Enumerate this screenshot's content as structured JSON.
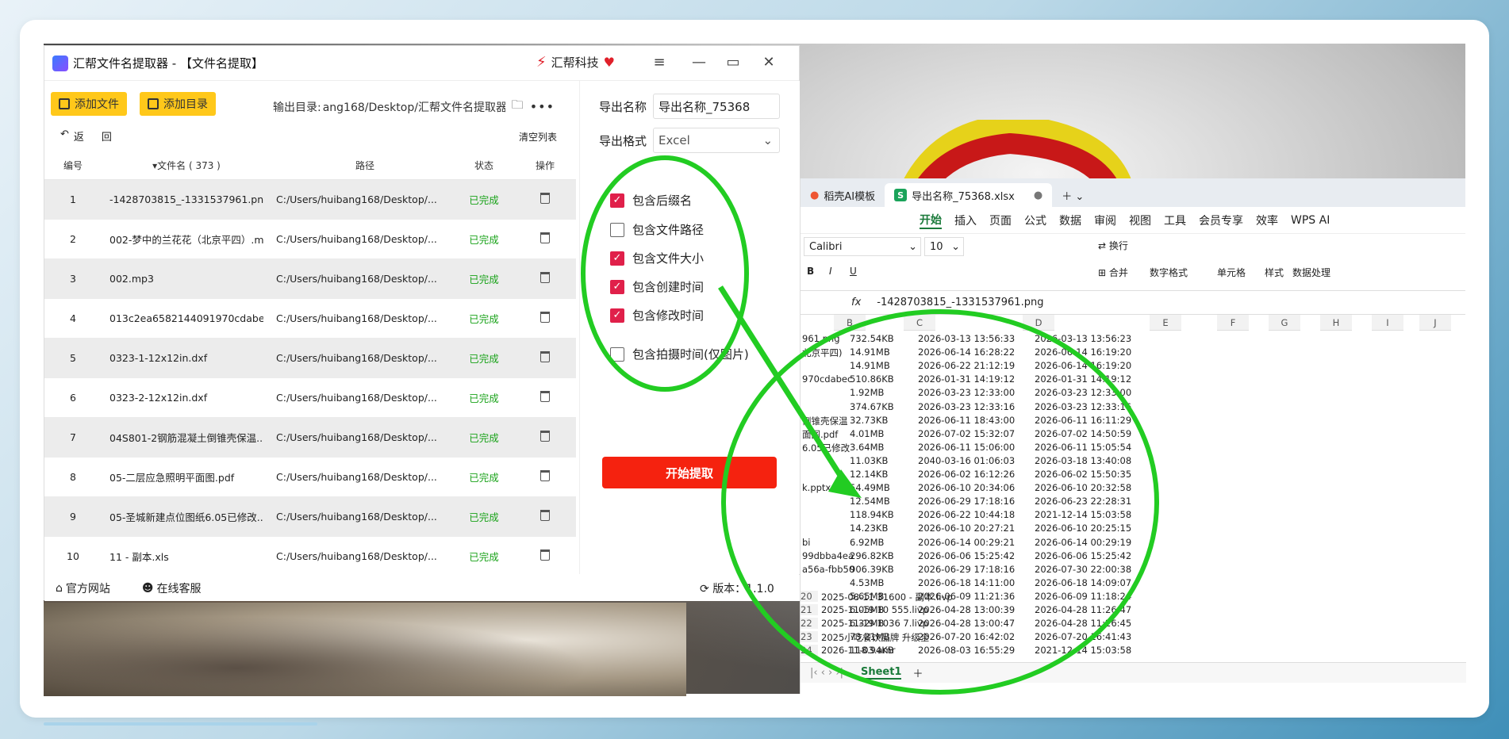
{
  "app": {
    "title": "汇帮文件名提取器 - 【文件名提取】",
    "brand": "汇帮科技",
    "add_file": "添加文件",
    "add_dir": "添加目录",
    "output_dir_label": "输出目录:",
    "output_dir_value": "ang168/Desktop/汇帮文件名提取器",
    "back": "返",
    "back2": "回",
    "clear": "清空列表",
    "headers": {
      "no": "编号",
      "name": "▾文件名 ( 373 )",
      "path": "路径",
      "status": "状态",
      "op": "操作"
    },
    "rows": [
      {
        "no": "1",
        "name": "-1428703815_-1331537961.png",
        "path": "C:/Users/huibang168/Desktop/...",
        "status": "已完成"
      },
      {
        "no": "2",
        "name": "002-梦中的兰花花（北京平四）.m...",
        "path": "C:/Users/huibang168/Desktop/...",
        "status": "已完成"
      },
      {
        "no": "3",
        "name": "002.mp3",
        "path": "C:/Users/huibang168/Desktop/...",
        "status": "已完成"
      },
      {
        "no": "4",
        "name": "013c2ea6582144091970cdabec...",
        "path": "C:/Users/huibang168/Desktop/...",
        "status": "已完成"
      },
      {
        "no": "5",
        "name": "0323-1-12x12in.dxf",
        "path": "C:/Users/huibang168/Desktop/...",
        "status": "已完成"
      },
      {
        "no": "6",
        "name": "0323-2-12x12in.dxf",
        "path": "C:/Users/huibang168/Desktop/...",
        "status": "已完成"
      },
      {
        "no": "7",
        "name": "04S801-2钢筋混凝土倒锥壳保温...",
        "path": "C:/Users/huibang168/Desktop/...",
        "status": "已完成"
      },
      {
        "no": "8",
        "name": "05-二层应急照明平面图.pdf",
        "path": "C:/Users/huibang168/Desktop/...",
        "status": "已完成"
      },
      {
        "no": "9",
        "name": "05-圣城新建点位图纸6.05已修改....",
        "path": "C:/Users/huibang168/Desktop/...",
        "status": "已完成"
      },
      {
        "no": "10",
        "name": "11 - 副本.xls",
        "path": "C:/Users/huibang168/Desktop/...",
        "status": "已完成"
      }
    ],
    "footer": {
      "site": "官方网站",
      "service": "在线客服",
      "version": "版本：1.1.0"
    }
  },
  "panel": {
    "export_name_label": "导出名称",
    "export_name_value": "导出名称_75368",
    "export_format_label": "导出格式",
    "export_format_value": "Excel",
    "options": [
      {
        "label": "包含后缀名",
        "checked": true
      },
      {
        "label": "包含文件路径",
        "checked": false
      },
      {
        "label": "包含文件大小",
        "checked": true
      },
      {
        "label": "包含创建时间",
        "checked": true
      },
      {
        "label": "包含修改时间",
        "checked": true
      },
      {
        "label": "包含拍摄时间(仅图片)",
        "checked": false
      }
    ],
    "start": "开始提取"
  },
  "wps": {
    "tab1": "稻壳AI模板",
    "tab2": "导出名称_75368.xlsx",
    "menu": [
      "开始",
      "插入",
      "页面",
      "公式",
      "数据",
      "审阅",
      "视图",
      "工具",
      "会员专享",
      "效率",
      "WPS AI"
    ],
    "font": "Calibri",
    "size": "10",
    "wrap": "换行",
    "merge": "合并",
    "numfmt": "数字格式",
    "cell": "单元格",
    "style": "样式",
    "dataproc": "数据处理",
    "fx": "fx",
    "formula": "-1428703815_-1331537961.png",
    "cols": [
      "B",
      "C",
      "D",
      "E",
      "F",
      "G",
      "H",
      "I",
      "J"
    ],
    "rows": [
      {
        "a": "961.png",
        "b": "732.54KB",
        "c": "2026-03-13 13:56:33",
        "d": "2026-03-13 13:56:23"
      },
      {
        "a": "北京平四)",
        "b": "14.91MB",
        "c": "2026-06-14 16:28:22",
        "d": "2026-06-14 16:19:20"
      },
      {
        "a": "",
        "b": "14.91MB",
        "c": "2026-06-22 21:12:19",
        "d": "2026-06-14 16:19:20"
      },
      {
        "a": "970cdabec",
        "b": "510.86KB",
        "c": "2026-01-31 14:19:12",
        "d": "2026-01-31 14:19:12"
      },
      {
        "a": "",
        "b": "1.92MB",
        "c": "2026-03-23 12:33:00",
        "d": "2026-03-23 12:33:00"
      },
      {
        "a": "",
        "b": "374.67KB",
        "c": "2026-03-23 12:33:16",
        "d": "2026-03-23 12:33:16"
      },
      {
        "a": "倒锥壳保温",
        "b": "32.73KB",
        "c": "2026-06-11 18:43:00",
        "d": "2026-06-11 16:11:29"
      },
      {
        "a": "面图.pdf",
        "b": "4.01MB",
        "c": "2026-07-02 15:32:07",
        "d": "2026-07-02 14:50:59"
      },
      {
        "a": "6.05已修改",
        "b": "3.64MB",
        "c": "2026-06-11 15:06:00",
        "d": "2026-06-11 15:05:54"
      },
      {
        "a": "",
        "b": "11.03KB",
        "c": "2040-03-16 01:06:03",
        "d": "2026-03-18 13:40:08"
      },
      {
        "a": "",
        "b": "12.14KB",
        "c": "2026-06-02 16:12:26",
        "d": "2026-06-02 15:50:35"
      },
      {
        "a": "k.pptx",
        "b": "54.49MB",
        "c": "2026-06-10 20:34:06",
        "d": "2026-06-10 20:32:58"
      },
      {
        "a": "",
        "b": "12.54MB",
        "c": "2026-06-29 17:18:16",
        "d": "2026-06-23 22:28:31"
      },
      {
        "a": "",
        "b": "118.94KB",
        "c": "2026-06-22 10:44:18",
        "d": "2021-12-14 15:03:58"
      },
      {
        "a": "",
        "b": "14.23KB",
        "c": "2026-06-10 20:27:21",
        "d": "2026-06-10 20:25:15"
      },
      {
        "a": "bi",
        "b": "6.92MB",
        "c": "2026-06-14 00:29:21",
        "d": "2026-06-14 00:29:19"
      },
      {
        "a": "99dbba4ea",
        "b": "296.82KB",
        "c": "2026-06-06 15:25:42",
        "d": "2026-06-06 15:25:42"
      },
      {
        "a": "a56a-fbb50",
        "b": "906.39KB",
        "c": "2026-06-29 17:18:16",
        "d": "2026-07-30 22:00:38"
      },
      {
        "a": "",
        "b": "4.53MB",
        "c": "2026-06-18 14:11:00",
        "d": "2026-06-18 14:09:07"
      },
      {
        "n": "20",
        "a": "2025-08-11 31600 - 副本.livp",
        "b": "5.65MB",
        "c": "2026-06-09 11:21:36",
        "d": "2026-06-09 11:18:24"
      },
      {
        "n": "21",
        "a": "2025-11-19 10 555.livp",
        "b": "6.05MB",
        "c": "2026-04-28 13:00:39",
        "d": "2026-04-28 11:26:47"
      },
      {
        "n": "22",
        "a": "2025-11-19 1036 7.livp",
        "b": "6.32MB",
        "c": "2026-04-28 13:00:47",
        "d": "2026-04-28 11:26:45"
      },
      {
        "n": "23",
        "a": "2025小吃餐饮品牌 升级全",
        "b": "73.21MB",
        "c": "2026-07-20 16:42:02",
        "d": "2026-07-20 16:41:43"
      },
      {
        "n": "24",
        "a": "2026-11-03.amr",
        "b": "118.94KB",
        "c": "2026-08-03 16:55:29",
        "d": "2021-12-14 15:03:58"
      }
    ],
    "sheet": "Sheet1"
  }
}
